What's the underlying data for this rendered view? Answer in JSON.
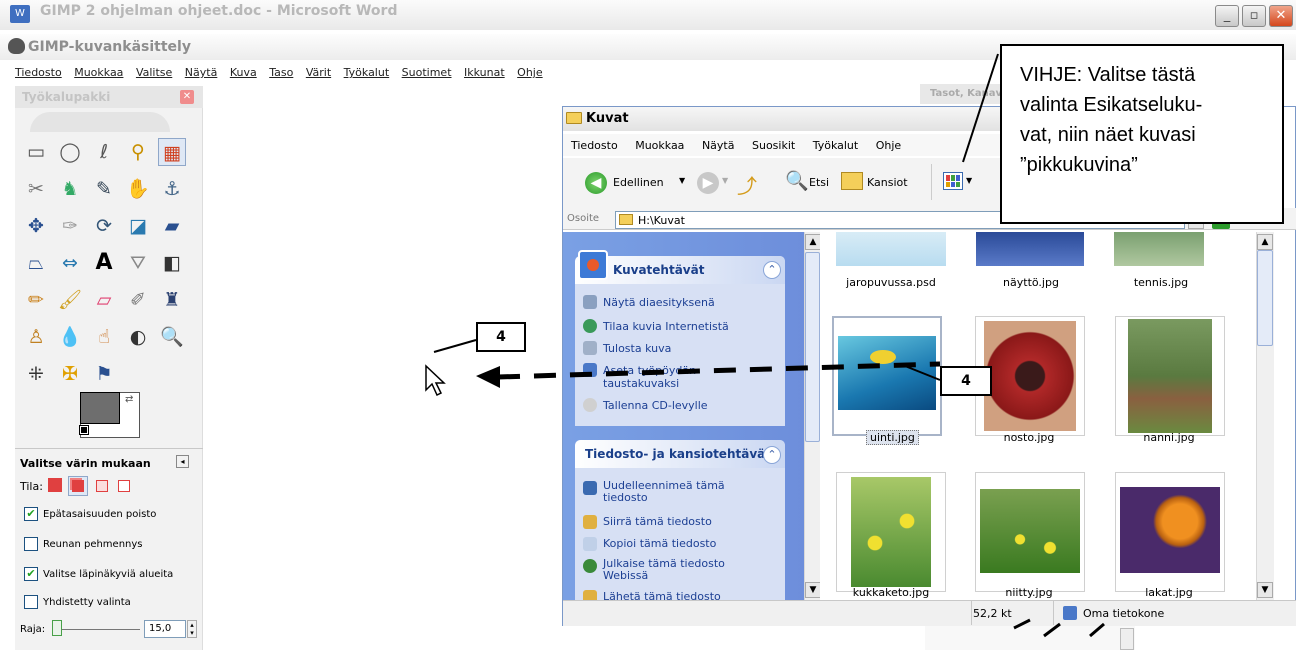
{
  "word": {
    "title": "GIMP 2 ohjelman ohjeet.doc - Microsoft Word"
  },
  "gimp": {
    "title": "GIMP-kuvankäsittely",
    "menu": [
      "Tiedosto",
      "Muokkaa",
      "Valitse",
      "Näytä",
      "Kuva",
      "Taso",
      "Värit",
      "Työkalut",
      "Suotimet",
      "Ikkunat",
      "Ohje"
    ],
    "toolbox_title": "Työkalupakki",
    "layers_title": "Tasot, Kanav",
    "options": {
      "title": "Valitse värin mukaan",
      "mode_label": "Tila:",
      "antialias": "Epätasaisuuden poisto",
      "feather": "Reunan pehmennys",
      "transparent": "Valitse läpinäkyviä alueita",
      "merged": "Yhdistetty valinta",
      "threshold_label": "Raja:",
      "threshold_value": "15,0",
      "threshold_fraction": 0.06,
      "checked": {
        "antialias": true,
        "feather": false,
        "transparent": true,
        "merged": false
      }
    }
  },
  "explorer": {
    "title": "Kuvat",
    "menu": [
      "Tiedosto",
      "Muokkaa",
      "Näytä",
      "Suosikit",
      "Työkalut",
      "Ohje"
    ],
    "toolbar": {
      "back": "Edellinen",
      "search": "Etsi",
      "folders": "Kansiot"
    },
    "address_label": "Osoite",
    "address": "H:\\Kuvat",
    "go": "Siirry",
    "picture_tasks": {
      "title": "Kuvatehtävät",
      "items": [
        "Näytä diaesityksenä",
        "Tilaa kuvia Internetistä",
        "Tulosta kuva",
        "Aseta työpöydän taustakuvaksi",
        "Tallenna CD-levylle"
      ]
    },
    "file_tasks": {
      "title": "Tiedosto- ja kansiotehtävä",
      "items": [
        "Uudelleennimeä tämä tiedosto",
        "Siirrä tämä tiedosto",
        "Kopioi tämä tiedosto",
        "Julkaise tämä tiedosto Webissä",
        "Lähetä tämä tiedosto"
      ]
    },
    "files": [
      "jaropuvussa.psd",
      "näyttö.jpg",
      "tennis.jpg",
      "uinti.jpg",
      "nosto.jpg",
      "nanni.jpg",
      "kukkaketo.jpg",
      "niitty.jpg",
      "lakat.jpg"
    ],
    "status": {
      "size": "52,2 kt",
      "location": "Oma tietokone"
    }
  },
  "annotations": {
    "hint": "VIHJE: Valitse tästä valinta Esikatselukuvat, niin näet kuvasi ”pikkukuvina”",
    "hint_lines": [
      "VIHJE: Valitse tästä",
      "valinta Esikatseluku-",
      "vat, niin näet kuvasi",
      "”pikkukuvina”"
    ],
    "step_left": "4",
    "step_right": "4"
  },
  "colors": {
    "gimp_fg": "#6e6e6e",
    "gimp_bg": "#ffffff",
    "xp_blue": "#0a246a",
    "taskpane": "#6d8edb"
  },
  "icons": [
    "gimp-logo-icon",
    "folder-icon",
    "back-arrow-icon",
    "forward-arrow-icon",
    "up-folder-icon",
    "search-icon",
    "folders-icon",
    "views-icon",
    "go-arrow-icon",
    "mouse-pointer-icon"
  ]
}
